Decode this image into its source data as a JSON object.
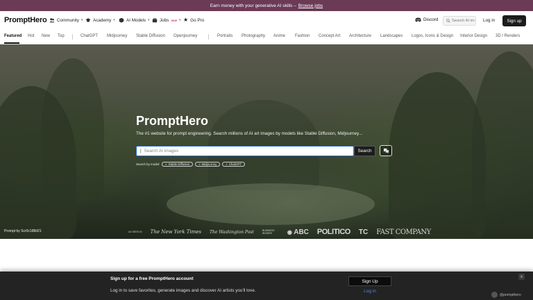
{
  "banner": {
    "text": "Earn money with your generative AI skills –",
    "link": "Browse jobs"
  },
  "nav": {
    "logo": "PromptHero",
    "items": [
      {
        "label": "Community"
      },
      {
        "label": "Academy"
      },
      {
        "label": "AI Models"
      },
      {
        "label": "Jobs",
        "badge": "new"
      },
      {
        "label": "Go Pro"
      }
    ],
    "discord": "Discord",
    "search_placeholder": "Search AI im",
    "login": "Log in",
    "signup": "Sign up"
  },
  "tabs": [
    "Featured",
    "Hot",
    "New",
    "Top",
    "ChatGPT",
    "Midjourney",
    "Stable Diffusion",
    "Openjourney",
    "Portraits",
    "Photography",
    "Anime",
    "Fashion",
    "Concept Art",
    "Architecture",
    "Landscapes",
    "Logos, Icons & Design",
    "Interior Design",
    "3D / Renders"
  ],
  "hero": {
    "title": "PromptHero",
    "subtitle": "The #1 website for prompt engineering. Search millions of AI art images by models like Stable Diffusion, Midjourney...",
    "search_placeholder": "Search AI images",
    "search_button": "Search",
    "by_model_label": "Search by model:",
    "models": [
      "Stable Diffusion",
      "Midjourney",
      "ChatGPT"
    ],
    "credit": "Prompt by Scr0c188d21",
    "as_seen_label": "AS SEEN IN",
    "publications": [
      "The New York Times",
      "The Washington Post",
      "BUSINESS INSIDER",
      "ABC",
      "POLITICO",
      "TC",
      "FAST COMPANY"
    ]
  },
  "modal": {
    "title": "Sign up for a free PromptHero account",
    "text": "Log in to save favorites, generate images and discover AI artists you'll love.",
    "signup": "Sign Up",
    "login": "Log in",
    "close": "x",
    "watermark": "@prompthero"
  },
  "colors": {
    "banner": "#6b3a55",
    "accent": "#2b6fd6",
    "dark": "#1c1c1c",
    "badge": "#e03e52"
  }
}
